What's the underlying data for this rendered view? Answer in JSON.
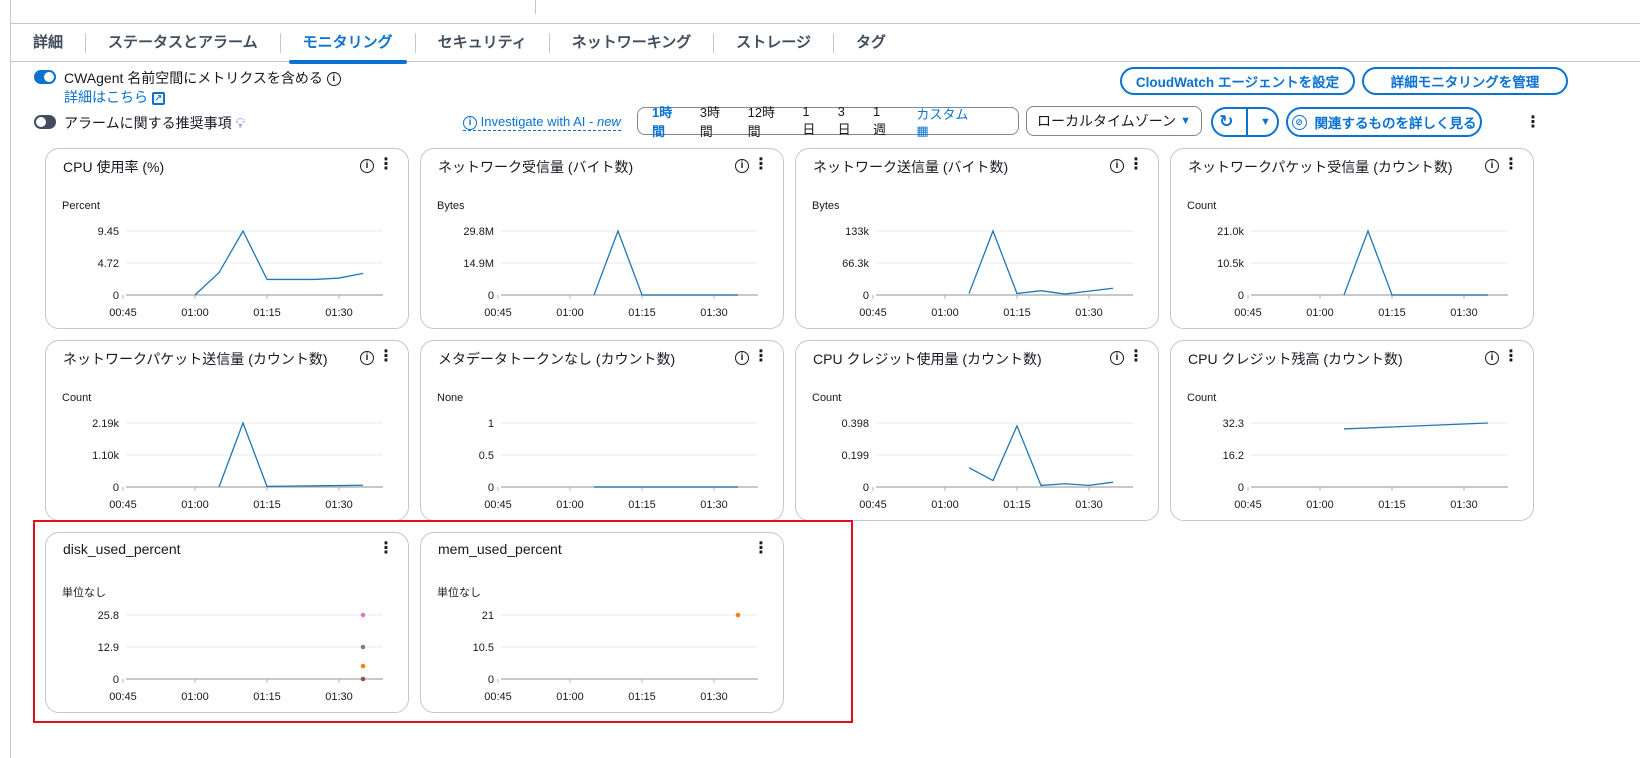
{
  "tabs": [
    "詳細",
    "ステータスとアラーム",
    "モニタリング",
    "セキュリティ",
    "ネットワーキング",
    "ストレージ",
    "タグ"
  ],
  "active_tab": 2,
  "cwagent_toggle": {
    "label": "CWAgent 名前空間にメトリクスを含める",
    "on": true,
    "link": "詳細はこちら"
  },
  "alarm_toggle": {
    "label": "アラームに関する推奨事項",
    "on": false
  },
  "buttons": {
    "cloudwatch_agent": "CloudWatch エージェントを設定",
    "detailed_monitoring": "詳細モニタリングを管理",
    "explore_related": "関連するものを詳しく見る"
  },
  "investigate": {
    "label": "Investigate with AI - ",
    "new": "new"
  },
  "time_ranges": [
    "1時間",
    "3時間",
    "12時間",
    "1日",
    "3日",
    "1週"
  ],
  "selected_range": "1時間",
  "custom_label": "カスタム",
  "timezone": "ローカルタイムゾーン",
  "colors": {
    "accent": "#0972d3",
    "line": "#1f77b4",
    "highlight": "#e0101a"
  },
  "chart_data": [
    {
      "type": "line",
      "title": "CPU 使用率 (%)",
      "ylabel": "Percent",
      "yticks": [
        "0",
        "4.72",
        "9.45"
      ],
      "ylim": [
        0,
        9.45
      ],
      "xticks": [
        "00:45",
        "01:00",
        "01:15",
        "01:30"
      ],
      "info": true,
      "series": [
        {
          "x": [
            "01:00",
            "01:05",
            "01:10",
            "01:15",
            "01:20",
            "01:25",
            "01:30",
            "01:35"
          ],
          "values": [
            0,
            3.3,
            9.45,
            2.3,
            2.3,
            2.3,
            2.5,
            3.2
          ],
          "color": "#1f77b4"
        }
      ]
    },
    {
      "type": "line",
      "title": "ネットワーク受信量 (バイト数)",
      "ylabel": "Bytes",
      "yticks": [
        "0",
        "14.9M",
        "29.8M"
      ],
      "ylim": [
        0,
        29.8
      ],
      "xticks": [
        "00:45",
        "01:00",
        "01:15",
        "01:30"
      ],
      "info": true,
      "series": [
        {
          "x": [
            "01:05",
            "01:10",
            "01:15",
            "01:20",
            "01:25",
            "01:30",
            "01:35"
          ],
          "values": [
            0,
            29.8,
            0,
            0,
            0,
            0,
            0
          ],
          "color": "#1f77b4"
        }
      ]
    },
    {
      "type": "line",
      "title": "ネットワーク送信量 (バイト数)",
      "ylabel": "Bytes",
      "yticks": [
        "0",
        "66.3k",
        "133k"
      ],
      "ylim": [
        0,
        133
      ],
      "xticks": [
        "00:45",
        "01:00",
        "01:15",
        "01:30"
      ],
      "info": true,
      "series": [
        {
          "x": [
            "01:05",
            "01:10",
            "01:15",
            "01:20",
            "01:25",
            "01:30",
            "01:35"
          ],
          "values": [
            3,
            133,
            3,
            9,
            2,
            8,
            14
          ],
          "color": "#1f77b4"
        }
      ]
    },
    {
      "type": "line",
      "title": "ネットワークパケット受信量 (カウント数)",
      "ylabel": "Count",
      "yticks": [
        "0",
        "10.5k",
        "21.0k"
      ],
      "ylim": [
        0,
        21.0
      ],
      "xticks": [
        "00:45",
        "01:00",
        "01:15",
        "01:30"
      ],
      "info": true,
      "series": [
        {
          "x": [
            "01:05",
            "01:10",
            "01:15",
            "01:20",
            "01:25",
            "01:30",
            "01:35"
          ],
          "values": [
            0,
            21.0,
            0,
            0,
            0,
            0,
            0
          ],
          "color": "#1f77b4"
        }
      ]
    },
    {
      "type": "line",
      "title": "ネットワークパケット送信量 (カウント数)",
      "ylabel": "Count",
      "yticks": [
        "0",
        "1.10k",
        "2.19k"
      ],
      "ylim": [
        0,
        2.19
      ],
      "xticks": [
        "00:45",
        "01:00",
        "01:15",
        "01:30"
      ],
      "info": true,
      "series": [
        {
          "x": [
            "01:05",
            "01:10",
            "01:15",
            "01:20",
            "01:25",
            "01:30",
            "01:35"
          ],
          "values": [
            0,
            2.19,
            0.02,
            0.03,
            0.04,
            0.05,
            0.06
          ],
          "color": "#1f77b4"
        }
      ]
    },
    {
      "type": "line",
      "title": "メタデータトークンなし (カウント数)",
      "ylabel": "None",
      "yticks": [
        "0",
        "0.5",
        "1"
      ],
      "ylim": [
        0,
        1
      ],
      "xticks": [
        "00:45",
        "01:00",
        "01:15",
        "01:30"
      ],
      "info": true,
      "series": [
        {
          "x": [
            "01:05",
            "01:10",
            "01:15",
            "01:20",
            "01:25",
            "01:30",
            "01:35"
          ],
          "values": [
            0,
            0,
            0,
            0,
            0,
            0,
            0
          ],
          "color": "#1f77b4"
        }
      ]
    },
    {
      "type": "line",
      "title": "CPU クレジット使用量 (カウント数)",
      "ylabel": "Count",
      "yticks": [
        "0",
        "0.199",
        "0.398"
      ],
      "ylim": [
        0,
        0.398
      ],
      "xticks": [
        "00:45",
        "01:00",
        "01:15",
        "01:30"
      ],
      "info": true,
      "series": [
        {
          "x": [
            "01:05",
            "01:10",
            "01:15",
            "01:20",
            "01:25",
            "01:30",
            "01:35"
          ],
          "values": [
            0.12,
            0.04,
            0.38,
            0.01,
            0.02,
            0.01,
            0.03
          ],
          "color": "#1f77b4"
        }
      ]
    },
    {
      "type": "line",
      "title": "CPU クレジット残高 (カウント数)",
      "ylabel": "Count",
      "yticks": [
        "0",
        "16.2",
        "32.3"
      ],
      "ylim": [
        0,
        32.3
      ],
      "xticks": [
        "00:45",
        "01:00",
        "01:15",
        "01:30"
      ],
      "info": true,
      "series": [
        {
          "x": [
            "01:05",
            "01:35"
          ],
          "values": [
            29.3,
            32.3
          ],
          "color": "#1f77b4"
        }
      ]
    },
    {
      "type": "scatter",
      "title": "disk_used_percent",
      "ylabel": "単位なし",
      "yticks": [
        "0",
        "12.9",
        "25.8"
      ],
      "ylim": [
        0,
        25.8
      ],
      "xticks": [
        "00:45",
        "01:00",
        "01:15",
        "01:30"
      ],
      "info": false,
      "series": [
        {
          "x": [
            "01:35"
          ],
          "values": [
            25.8
          ],
          "color": "#e377c2"
        },
        {
          "x": [
            "01:35"
          ],
          "values": [
            12.9
          ],
          "color": "#7f7f7f"
        },
        {
          "x": [
            "01:35"
          ],
          "values": [
            5.2
          ],
          "color": "#ff7f0e"
        },
        {
          "x": [
            "01:35"
          ],
          "values": [
            0
          ],
          "color": "#8c564b"
        }
      ]
    },
    {
      "type": "scatter",
      "title": "mem_used_percent",
      "ylabel": "単位なし",
      "yticks": [
        "0",
        "10.5",
        "21"
      ],
      "ylim": [
        0,
        21
      ],
      "xticks": [
        "00:45",
        "01:00",
        "01:15",
        "01:30"
      ],
      "info": false,
      "series": [
        {
          "x": [
            "01:35"
          ],
          "values": [
            21
          ],
          "color": "#ff7f0e"
        }
      ]
    }
  ]
}
